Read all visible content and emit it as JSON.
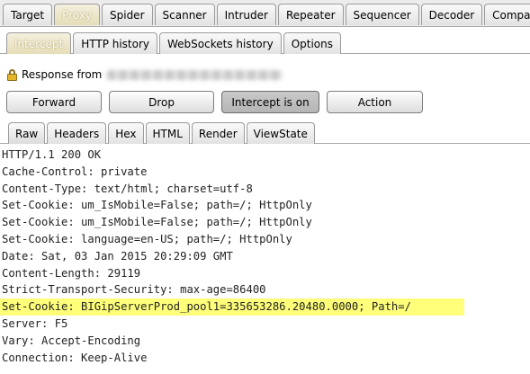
{
  "main_tabs": [
    "Target",
    "Proxy",
    "Spider",
    "Scanner",
    "Intruder",
    "Repeater",
    "Sequencer",
    "Decoder",
    "Comparer"
  ],
  "sub_tabs": [
    "Intercept",
    "HTTP history",
    "WebSockets history",
    "Options"
  ],
  "response_label": "Response from",
  "buttons": {
    "forward": "Forward",
    "drop": "Drop",
    "intercept": "Intercept is on",
    "action": "Action"
  },
  "view_tabs": [
    "Raw",
    "Headers",
    "Hex",
    "HTML",
    "Render",
    "ViewState"
  ],
  "response_lines": [
    "HTTP/1.1 200 OK",
    "Cache-Control: private",
    "Content-Type: text/html; charset=utf-8",
    "Set-Cookie: um_IsMobile=False; path=/; HttpOnly",
    "Set-Cookie: um_IsMobile=False; path=/; HttpOnly",
    "Set-Cookie: language=en-US; path=/; HttpOnly",
    "Date: Sat, 03 Jan 2015 20:29:09 GMT",
    "Content-Length: 29119",
    "Strict-Transport-Security: max-age=86400",
    "Set-Cookie: BIGipServerProd_pool1=335653286.20480.0000; Path=/",
    "Server: F5",
    "Vary: Accept-Encoding",
    "Connection: Keep-Alive"
  ],
  "highlight_color": "#ffff7a"
}
